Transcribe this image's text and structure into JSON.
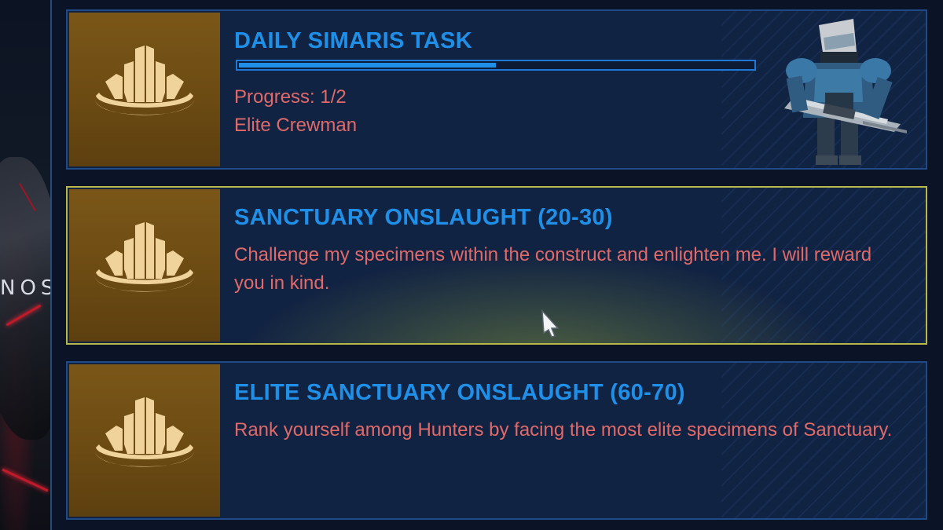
{
  "background": {
    "side_text": "NOS"
  },
  "tasks": [
    {
      "title": "DAILY SIMARIS TASK",
      "progress_label": "Progress: 1/2",
      "progress_fraction": 0.5,
      "target": "Elite Crewman",
      "icon": "sanctuary-icon"
    },
    {
      "title": "SANCTUARY ONSLAUGHT (20-30)",
      "description": "Challenge my specimens within the construct and enlighten me. I will reward you in kind.",
      "icon": "sanctuary-icon",
      "selected": true
    },
    {
      "title": "ELITE SANCTUARY ONSLAUGHT (60-70)",
      "description": "Rank yourself among Hunters by facing the most elite specimens of Sanctuary.",
      "icon": "sanctuary-icon"
    }
  ],
  "colors": {
    "title": "#1f8fe8",
    "description": "#e06a6a",
    "card_bg": "#112342",
    "card_border": "#1f4a85",
    "selected_border": "#b8b84a",
    "icon_bg": "#6c4b13",
    "icon_fg": "#f0d39a"
  }
}
